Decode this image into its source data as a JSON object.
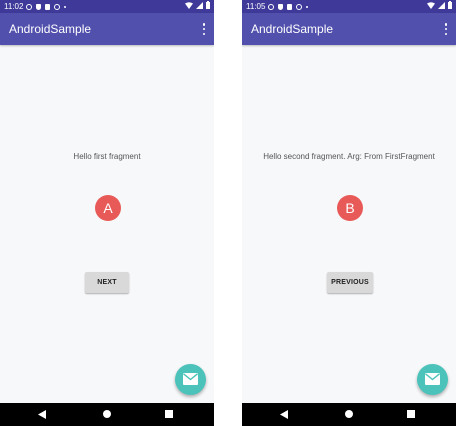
{
  "colors": {
    "status_bar": "#3f3a9a",
    "app_bar": "#5150ad",
    "background": "#f7f8fa",
    "marker": "#e85a57",
    "fab": "#4cc3ba",
    "button": "#d9d9d9",
    "nav_bar": "#000000"
  },
  "screens": [
    {
      "status_time": "11:02",
      "app_title": "AndroidSample",
      "fragment_text": "Hello first fragment",
      "marker_label": "A",
      "button_label": "NEXT",
      "icons": [
        "gear-icon",
        "shield-icon",
        "sim-card-icon",
        "at-sign-icon",
        "wifi-icon",
        "signal-icon",
        "battery-icon",
        "overflow-menu-icon",
        "email-icon",
        "back-icon",
        "home-icon",
        "recents-icon"
      ]
    },
    {
      "status_time": "11:05",
      "app_title": "AndroidSample",
      "fragment_text": "Hello second fragment. Arg: From FirstFragment",
      "marker_label": "B",
      "button_label": "PREVIOUS",
      "icons": [
        "gear-icon",
        "shield-icon",
        "sim-card-icon",
        "at-sign-icon",
        "wifi-icon",
        "signal-icon",
        "battery-icon",
        "overflow-menu-icon",
        "email-icon",
        "back-icon",
        "home-icon",
        "recents-icon"
      ]
    }
  ]
}
